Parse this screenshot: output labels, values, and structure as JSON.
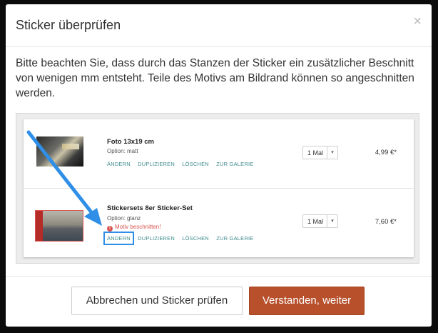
{
  "modal": {
    "title": "Sticker überprüfen",
    "close_icon": "×",
    "intro": "Bitte beachten Sie, dass durch das Stanzen der Sticker ein zusätzlicher Beschnitt von wenigen mm entsteht. Teile des Motivs am Bildrand können so angeschnitten werden."
  },
  "items": [
    {
      "name": "Foto 13x19 cm",
      "option": "Option: matt",
      "actions": [
        "ÄNDERN",
        "DUPLIZIEREN",
        "LÖSCHEN",
        "ZUR GALERIE"
      ],
      "qty": "1 Mal",
      "price": "4,99 €*"
    },
    {
      "name": "Stickersets 8er Sticker-Set",
      "option": "Option: glanz",
      "warning": "Motiv beschnitten!",
      "actions": [
        "ÄNDERN",
        "DUPLIZIEREN",
        "LÖSCHEN",
        "ZUR GALERIE"
      ],
      "qty": "1 Mal",
      "price": "7,60 €*"
    }
  ],
  "footer": {
    "cancel_label": "Abbrechen und Sticker prüfen",
    "confirm_label": "Verstanden, weiter"
  },
  "colors": {
    "accent_button": "#b7502b",
    "link": "#3f8a8c",
    "warning": "#d9534f",
    "highlight_arrow": "#2f8ee6"
  }
}
